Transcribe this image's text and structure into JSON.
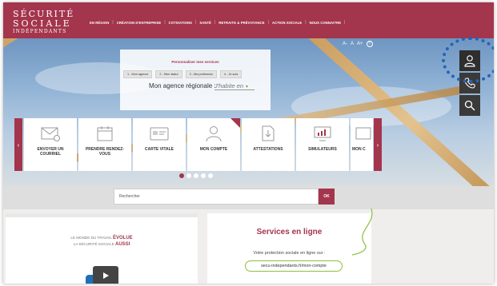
{
  "header": {
    "logo": {
      "line1": "SÉCURITÉ",
      "line2": "SOCIALE",
      "line3": "INDÉPENDANTS"
    },
    "nav": [
      {
        "label": "EN RÉGION"
      },
      {
        "label": "CRÉATION D'ENTREPRISE"
      },
      {
        "label": "COTISATIONS"
      },
      {
        "label": "SANTÉ"
      },
      {
        "label": "RETRAITE & PRÉVOYANCE"
      },
      {
        "label": "ACTION SOCIALE"
      },
      {
        "label": "NOUS CONNAITRE"
      }
    ]
  },
  "font_controls": {
    "small": "A-",
    "normal": "A",
    "large": "A+",
    "help": "?"
  },
  "side_icons": [
    {
      "icon": "user-icon"
    },
    {
      "icon": "phone-icon"
    },
    {
      "icon": "search-icon"
    }
  ],
  "agency_panel": {
    "title": "Personnaliser mes services",
    "steps": [
      "1 - Mon agence",
      "2 - Mon statut",
      "3 - Ma profession",
      "4 - Je suis"
    ],
    "label": "Mon agence régionale :",
    "select_value": "J'habite en"
  },
  "tiles": [
    {
      "label": "ENVOYER UN COURRIEL",
      "icon": "mail-icon"
    },
    {
      "label": "PRENDRE RENDEZ-VOUS",
      "icon": "calendar-icon"
    },
    {
      "label": "CARTE VITALE",
      "icon": "card-icon"
    },
    {
      "label": "MON COMPTE",
      "icon": "account-icon"
    },
    {
      "label": "ATTESTATIONS",
      "icon": "download-doc-icon"
    },
    {
      "label": "SIMULATEURS",
      "icon": "chart-screen-icon"
    },
    {
      "label": "MON C",
      "icon": "partial-icon"
    }
  ],
  "carousel": {
    "dots": 5,
    "active": 0
  },
  "search": {
    "placeholder": "Rechercher",
    "button": "OK"
  },
  "video": {
    "line1_prefix": "LE MONDE DU TRAVAIL",
    "line1_strong": "ÉVOLUE",
    "line2_prefix": "LA SÉCURITÉ SOCIALE",
    "line2_strong": "AUSSI"
  },
  "services": {
    "title": "Services en ligne",
    "subtitle": "Votre protection sociale en ligne sur :",
    "url": "secu-independants.fr/mon-compte"
  },
  "colors": {
    "brand": "#a3354d",
    "accent_green": "#8dbf3c",
    "highlight": "#2563b8"
  }
}
